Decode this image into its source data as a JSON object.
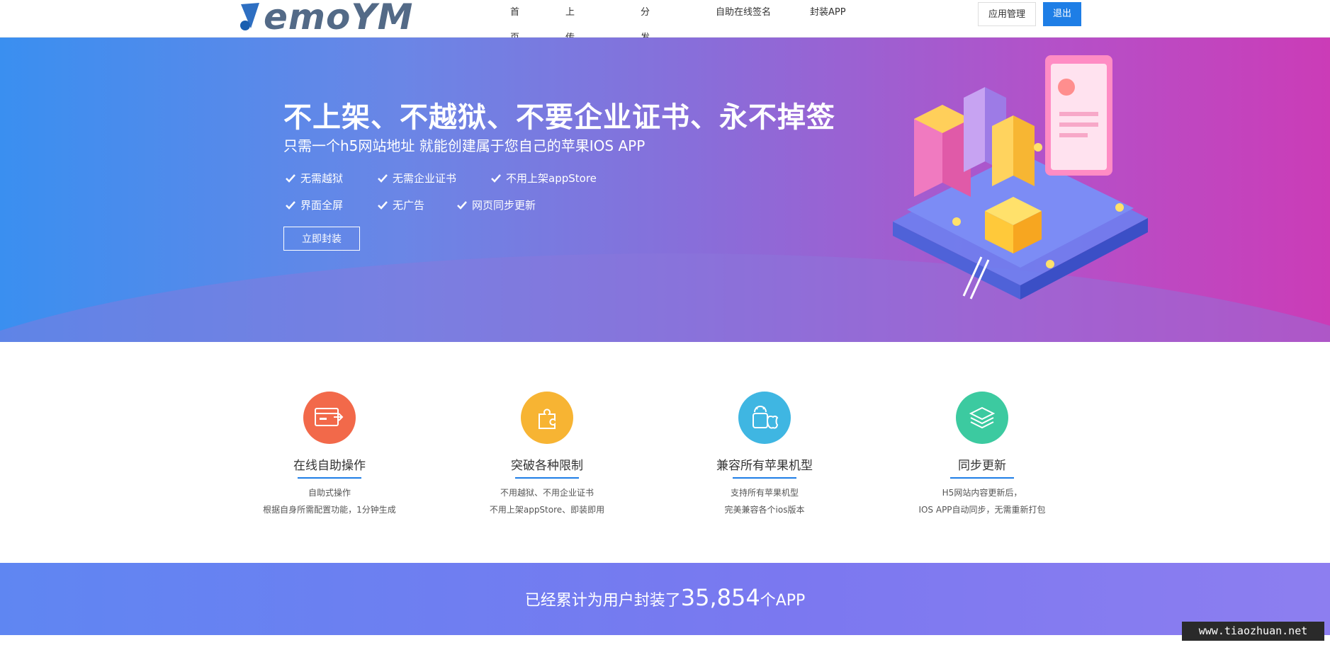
{
  "header": {
    "logo_text": "emoYM",
    "nav": [
      "首页",
      "上传分发",
      "分发价格",
      "自助在线签名",
      "封装APP"
    ],
    "manage_label": "应用管理",
    "logout_label": "退出"
  },
  "hero": {
    "title": "不上架、不越狱、不要企业证书、永不掉签",
    "subtitle": "只需一个h5网站地址 就能创建属于您自己的苹果IOS APP",
    "features_row1": [
      "无需越狱",
      "无需企业证书",
      "不用上架appStore"
    ],
    "features_row2": [
      "界面全屏",
      "无广告",
      "网页同步更新"
    ],
    "cta_label": "立即封装"
  },
  "features": [
    {
      "title": "在线自助操作",
      "desc1": "自助式操作",
      "desc2": "根据自身所需配置功能，1分钟生成",
      "color": "#f2694a",
      "icon": "card-arrow-icon"
    },
    {
      "title": "突破各种限制",
      "desc1": "不用越狱、不用企业证书",
      "desc2": "不用上架appStore、即装即用",
      "color": "#f7b433",
      "icon": "puzzle-icon"
    },
    {
      "title": "兼容所有苹果机型",
      "desc1": "支持所有苹果机型",
      "desc2": "完美兼容各个ios版本",
      "color": "#3fb6e2",
      "icon": "android-apple-icon"
    },
    {
      "title": "同步更新",
      "desc1": "H5网站内容更新后，",
      "desc2": "IOS APP自动同步，无需重新打包",
      "color": "#3ccaa0",
      "icon": "layers-icon"
    }
  ],
  "banner": {
    "prefix": "已经累计为用户封装了",
    "count": "35,854",
    "suffix": "个APP"
  },
  "watermark": "www.tiaozhuan.net",
  "colors": {
    "primary": "#1e7ee6",
    "hero_start": "#3a8ff0",
    "hero_end": "#cb3cb7"
  }
}
